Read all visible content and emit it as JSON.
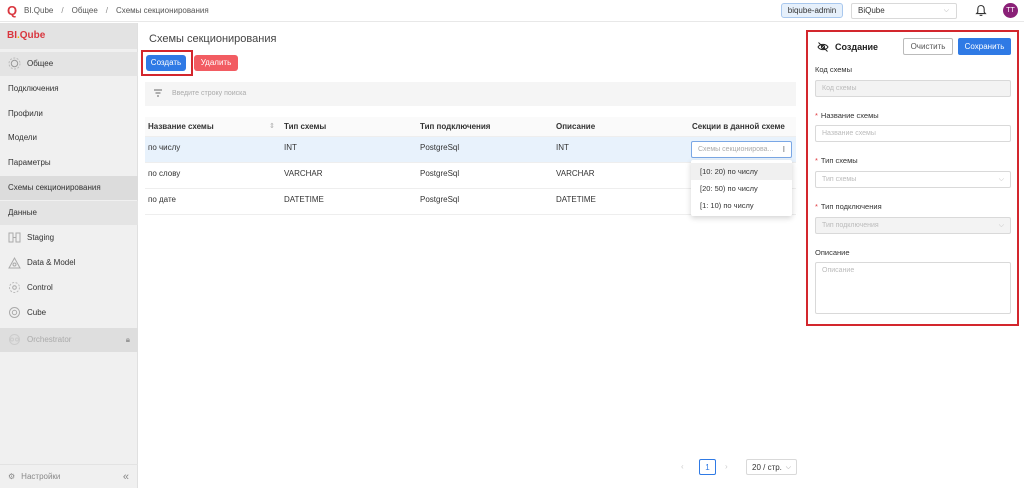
{
  "header": {
    "breadcrumbs": [
      "BI.Qube",
      "Общее",
      "Схемы секционирования"
    ],
    "user_tag": "biqube-admin",
    "workspace_select": "BiQube",
    "avatar_initials": "TT"
  },
  "sidebar": {
    "brand_prefix": "BI",
    "brand_dot": ".",
    "brand_suffix": "Qube",
    "items": [
      {
        "label": "Общее"
      },
      {
        "label": "Подключения"
      },
      {
        "label": "Профили"
      },
      {
        "label": "Модели"
      },
      {
        "label": "Параметры"
      },
      {
        "label": "Схемы секционирования"
      },
      {
        "label": "Данные"
      },
      {
        "label": "Staging"
      },
      {
        "label": "Data & Model"
      },
      {
        "label": "Control"
      },
      {
        "label": "Cube"
      },
      {
        "label": "Orchestrator"
      }
    ],
    "footer_label": "Настройки"
  },
  "main": {
    "title": "Схемы секционирования",
    "create_label": "Создать",
    "delete_label": "Удалить",
    "search_placeholder": "Введите строку поиска",
    "columns": [
      "Название схемы",
      "Тип схемы",
      "Тип подключения",
      "Описание",
      "Секции в данной схеме"
    ],
    "rows": [
      {
        "name": "по числу",
        "type": "INT",
        "conn": "PostgreSql",
        "desc": "INT"
      },
      {
        "name": "по слову",
        "type": "VARCHAR",
        "conn": "PostgreSql",
        "desc": "VARCHAR"
      },
      {
        "name": "по дате",
        "type": "DATETIME",
        "conn": "PostgreSql",
        "desc": "DATETIME"
      }
    ],
    "sections_placeholder": "Схемы секционирова...",
    "sections_options": [
      "[10: 20) по числу",
      "[20: 50) по числу",
      "[1: 10) по числу"
    ],
    "pagination": {
      "current_page": "1",
      "page_size": "20 / стр."
    }
  },
  "panel": {
    "title": "Создание",
    "clear_label": "Очистить",
    "save_label": "Сохранить",
    "code_label": "Код схемы",
    "code_placeholder": "Код схемы",
    "name_label": "Название схемы",
    "name_placeholder": "Название схемы",
    "type_label": "Тип схемы",
    "type_placeholder": "Тип схемы",
    "conn_label": "Тип подключения",
    "conn_placeholder": "Тип подключения",
    "desc_label": "Описание",
    "desc_placeholder": "Описание"
  }
}
